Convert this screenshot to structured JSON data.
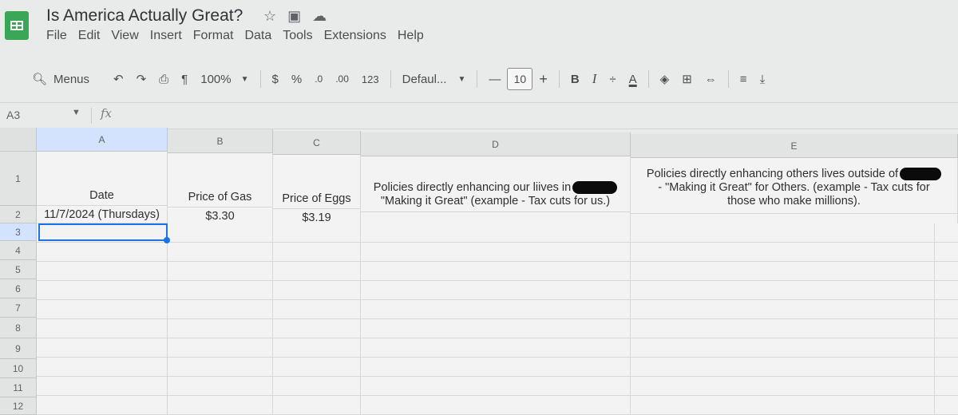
{
  "doc": {
    "title": "Is America Actually Great?",
    "icons": [
      "star-icon",
      "move-to-folder-icon",
      "cloud-status-icon"
    ]
  },
  "menu": [
    "File",
    "Edit",
    "View",
    "Insert",
    "Format",
    "Data",
    "Tools",
    "Extensions",
    "Help"
  ],
  "toolbar": {
    "search_label": "Menus",
    "zoom": "100%",
    "currency": "$",
    "percent": "%",
    "dec_decrease": ".0",
    "dec_increase": ".00",
    "number_format": "123",
    "font": "Defaul...",
    "font_minus": "—",
    "font_size": "10",
    "font_plus": "+",
    "bold": "B",
    "italic": "I",
    "strike": "÷",
    "text_color": "A"
  },
  "formula": {
    "name_box": "A3",
    "fx": "fx"
  },
  "columns": [
    "A",
    "B",
    "C",
    "D",
    "E"
  ],
  "rows": [
    "1",
    "2",
    "3",
    "4",
    "5",
    "6",
    "7",
    "8",
    "9",
    "10",
    "11",
    "12"
  ],
  "headers_row1": {
    "a": "Date",
    "b": "Price of Gas",
    "c": "Price of Eggs",
    "d_line1": "Policies directly enhancing our liives in",
    "d_line2": "\"Making it Great\" (example - Tax cuts for us.)",
    "e_line1": "Policies directly enhancing others lives outside of",
    "e_line2": "- \"Making it Great\" for Others. (example - Tax cuts for",
    "e_line3": "those who make millions)."
  },
  "row2": {
    "a": "11/7/2024 (Thursdays)",
    "b": "$3.30",
    "c": "$3.19"
  },
  "colors": {
    "accent": "#1a73e8",
    "sheets_green": "#3aa757"
  }
}
